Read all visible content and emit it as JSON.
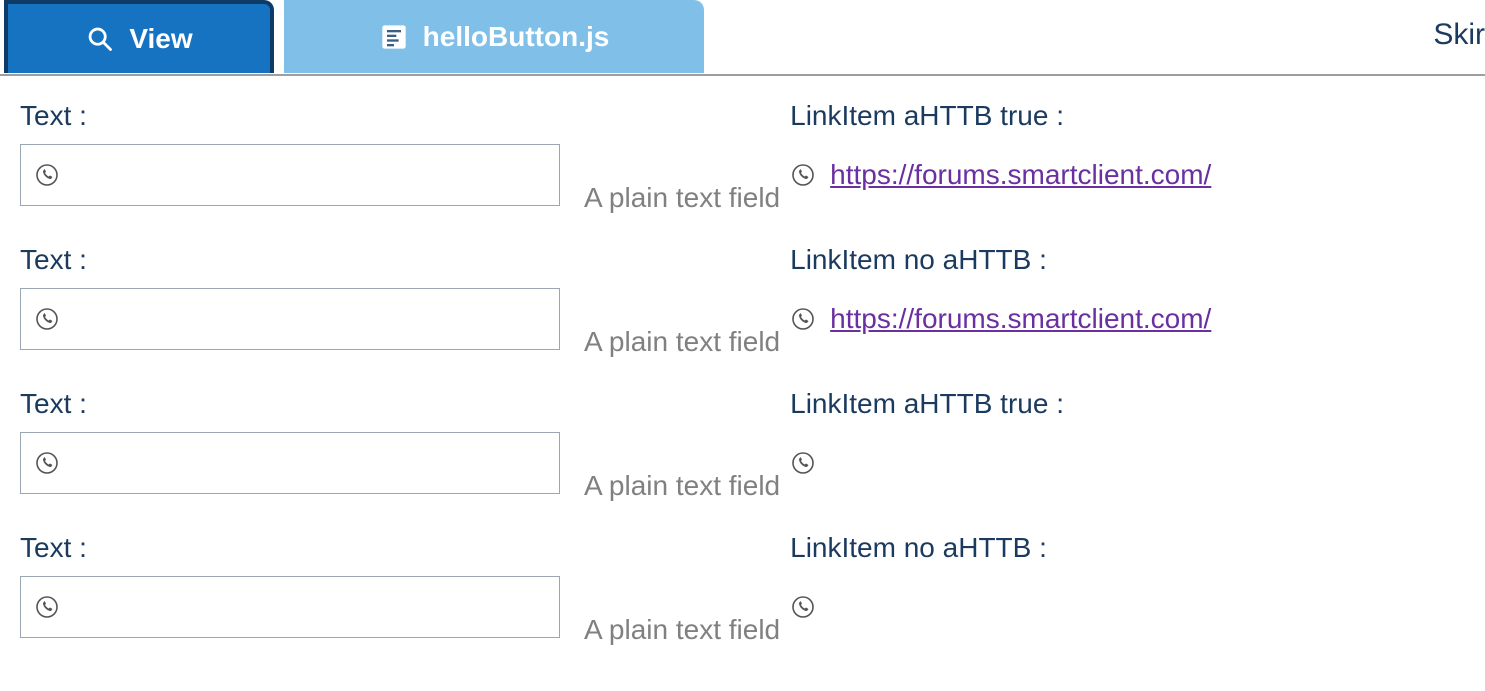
{
  "tabs": {
    "active": {
      "label": "View"
    },
    "inactive": {
      "label": "helloButton.js"
    }
  },
  "topRight": {
    "skin": "Skir"
  },
  "rows": [
    {
      "text_label": "Text :",
      "text_value": "",
      "hint": "A plain text field",
      "link_label": "LinkItem aHTTB true :",
      "link_value": "https://forums.smartclient.com/",
      "has_link": true
    },
    {
      "text_label": "Text :",
      "text_value": "",
      "hint": "A plain text field",
      "link_label": "LinkItem no aHTTB :",
      "link_value": "https://forums.smartclient.com/",
      "has_link": true
    },
    {
      "text_label": "Text :",
      "text_value": "",
      "hint": "A plain text field",
      "link_label": "LinkItem aHTTB true :",
      "link_value": "",
      "has_link": false
    },
    {
      "text_label": "Text :",
      "text_value": "",
      "hint": "A plain text field",
      "link_label": "LinkItem no aHTTB :",
      "link_value": "",
      "has_link": false
    }
  ]
}
